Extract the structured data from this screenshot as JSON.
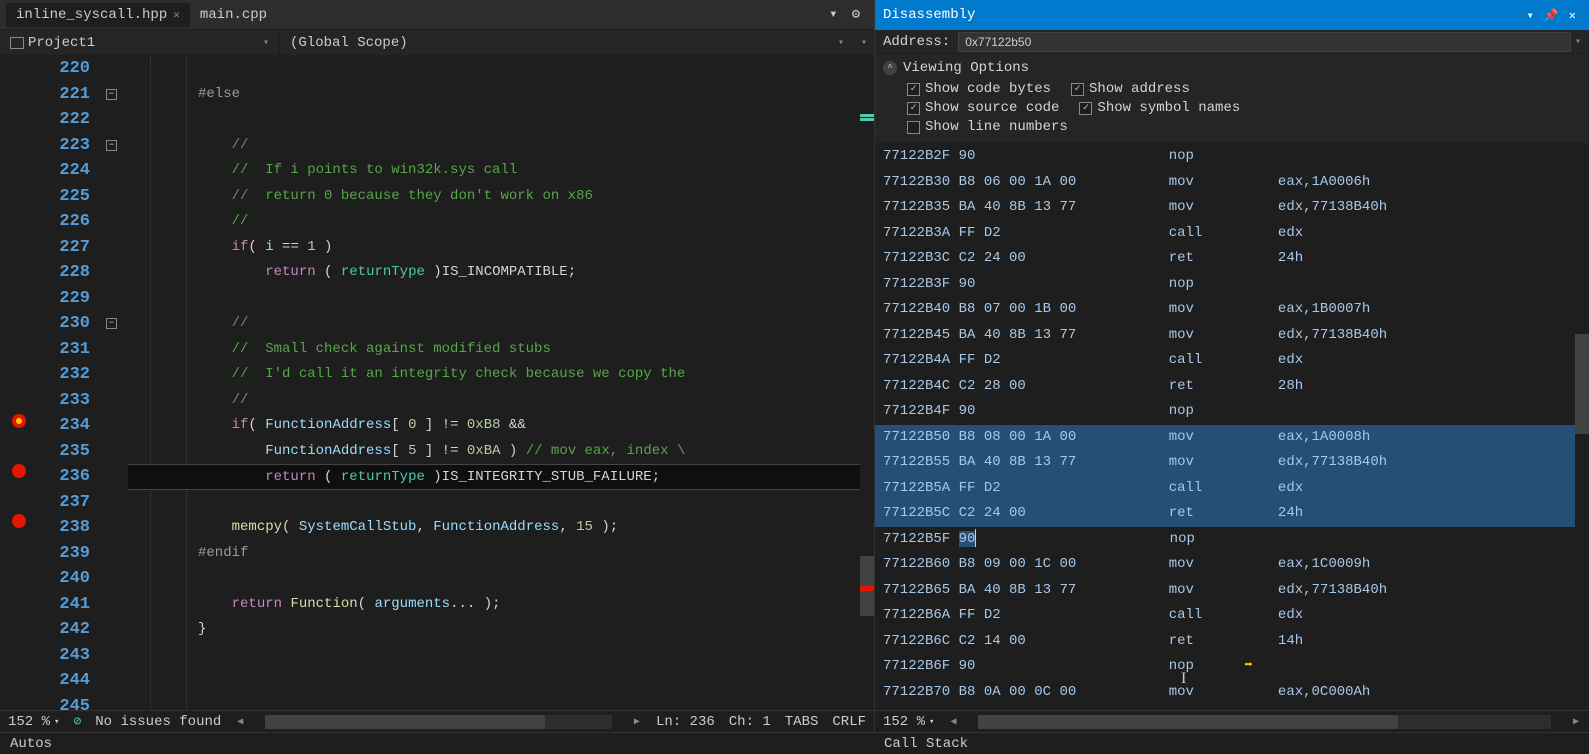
{
  "tabs": {
    "active": "inline_syscall.hpp",
    "second": "main.cpp"
  },
  "nav": {
    "project": "Project1",
    "scope": "(Global Scope)"
  },
  "zoom": "152 %",
  "status": {
    "issues": "No issues found",
    "line": "Ln: 236",
    "col": "Ch: 1",
    "tabs": "TABS",
    "crlf": "CRLF"
  },
  "code": {
    "start": 220,
    "lines": [
      {
        "n": 220,
        "html": ""
      },
      {
        "n": 221,
        "html": "<span class='pre'>#else</span>",
        "fold": true
      },
      {
        "n": 222,
        "html": ""
      },
      {
        "n": 223,
        "html": "    <span class='cm'>//</span>",
        "fold": true
      },
      {
        "n": 224,
        "html": "    <span class='cm'>//  If i points to win32k.sys call</span>"
      },
      {
        "n": 225,
        "html": "    <span class='cm'>//  return 0 because they don't work on x86</span>"
      },
      {
        "n": 226,
        "html": "    <span class='cm'>//</span>"
      },
      {
        "n": 227,
        "html": "    <span class='kw'>if</span><span class='txt'>( </span><span class='param'>i</span><span class='txt'> == </span><span class='num'>1</span><span class='txt'> )</span>"
      },
      {
        "n": 228,
        "html": "        <span class='kw'>return</span><span class='txt'> ( </span><span class='ty'>returnType</span><span class='txt'> )</span><span class='txt'>IS_INCOMPATIBLE;</span>"
      },
      {
        "n": 229,
        "html": ""
      },
      {
        "n": 230,
        "html": "    <span class='cm'>//</span>",
        "fold": true
      },
      {
        "n": 231,
        "html": "    <span class='cm'>//  Small check against modified stubs</span>"
      },
      {
        "n": 232,
        "html": "    <span class='cm'>//  I'd call it an integrity check because we copy the</span>"
      },
      {
        "n": 233,
        "html": "    <span class='cm'>//</span>"
      },
      {
        "n": 234,
        "html": "    <span class='kw'>if</span><span class='txt'>( </span><span class='param'>FunctionAddress</span><span class='txt'>[ </span><span class='num'>0</span><span class='txt'> ] != </span><span class='num'>0xB8</span><span class='txt'> &amp;&amp;</span>",
        "bp": "active"
      },
      {
        "n": 235,
        "html": "        <span class='param'>FunctionAddress</span><span class='txt'>[ </span><span class='num'>5</span><span class='txt'> ] != </span><span class='num'>0xBA</span><span class='txt'> ) </span><span class='cm'>// mov eax, index \\</span>"
      },
      {
        "n": 236,
        "html": "        <span class='kw'>return</span><span class='txt'> ( </span><span class='ty'>returnType</span><span class='txt'> )IS_INTEGRITY_STUB_FAILURE;</span>",
        "bp": "normal",
        "current": true
      },
      {
        "n": 237,
        "html": ""
      },
      {
        "n": 238,
        "html": "    <span class='fn'>memcpy</span><span class='txt'>( </span><span class='param'>SystemCallStub</span><span class='txt'>, </span><span class='param'>FunctionAddress</span><span class='txt'>, </span><span class='num'>15</span><span class='txt'> );</span>",
        "bp": "normal"
      },
      {
        "n": 239,
        "html": "<span class='pre'>#endif</span>"
      },
      {
        "n": 240,
        "html": ""
      },
      {
        "n": 241,
        "html": "    <span class='kw'>return</span><span class='txt'> </span><span class='fn'>Function</span><span class='txt'>( </span><span class='param'>arguments</span><span class='txt'>... );</span>"
      },
      {
        "n": 242,
        "html": "<span class='txt'>}</span>"
      },
      {
        "n": 243,
        "html": ""
      },
      {
        "n": 244,
        "html": ""
      },
      {
        "n": 245,
        "html": ""
      }
    ]
  },
  "disasm": {
    "title": "Disassembly",
    "address_label": "Address:",
    "address_value": "0x77122b50",
    "viewing_options_label": "Viewing Options",
    "opts": {
      "code_bytes": "Show code bytes",
      "address": "Show address",
      "source": "Show source code",
      "symbols": "Show symbol names",
      "line_nums": "Show line numbers"
    },
    "zoom": "152 %",
    "lines": [
      {
        "addr": "77122B2F",
        "bytes": "90",
        "mnem": "nop",
        "oper": ""
      },
      {
        "addr": "77122B30",
        "bytes": "B8 06 00 1A 00",
        "mnem": "mov",
        "oper": "eax,1A0006h"
      },
      {
        "addr": "77122B35",
        "bytes": "BA 40 8B 13 77",
        "mnem": "mov",
        "oper": "edx,77138B40h"
      },
      {
        "addr": "77122B3A",
        "bytes": "FF D2",
        "mnem": "call",
        "oper": "edx"
      },
      {
        "addr": "77122B3C",
        "bytes": "C2 24 00",
        "mnem": "ret",
        "oper": "24h"
      },
      {
        "addr": "77122B3F",
        "bytes": "90",
        "mnem": "nop",
        "oper": ""
      },
      {
        "addr": "77122B40",
        "bytes": "B8 07 00 1B 00",
        "mnem": "mov",
        "oper": "eax,1B0007h"
      },
      {
        "addr": "77122B45",
        "bytes": "BA 40 8B 13 77",
        "mnem": "mov",
        "oper": "edx,77138B40h"
      },
      {
        "addr": "77122B4A",
        "bytes": "FF D2",
        "mnem": "call",
        "oper": "edx"
      },
      {
        "addr": "77122B4C",
        "bytes": "C2 28 00",
        "mnem": "ret",
        "oper": "28h"
      },
      {
        "addr": "77122B4F",
        "bytes": "90",
        "mnem": "nop",
        "oper": ""
      },
      {
        "addr": "77122B50",
        "bytes": "B8 08 00 1A 00",
        "mnem": "mov",
        "oper": "eax,1A0008h",
        "sel": true
      },
      {
        "addr": "77122B55",
        "bytes": "BA 40 8B 13 77",
        "mnem": "mov",
        "oper": "edx,77138B40h",
        "sel": true
      },
      {
        "addr": "77122B5A",
        "bytes": "FF D2",
        "mnem": "call",
        "oper": "edx",
        "sel": true
      },
      {
        "addr": "77122B5C",
        "bytes": "C2 24 00",
        "mnem": "ret",
        "oper": "24h",
        "sel": true
      },
      {
        "addr": "77122B5F",
        "bytes": "90",
        "mnem": "nop",
        "oper": "",
        "sel": "partial"
      },
      {
        "addr": "77122B60",
        "bytes": "B8 09 00 1C 00",
        "mnem": "mov",
        "oper": "eax,1C0009h"
      },
      {
        "addr": "77122B65",
        "bytes": "BA 40 8B 13 77",
        "mnem": "mov",
        "oper": "edx,77138B40h"
      },
      {
        "addr": "77122B6A",
        "bytes": "FF D2",
        "mnem": "call",
        "oper": "edx"
      },
      {
        "addr": "77122B6C",
        "bytes": "C2 14 00",
        "mnem": "ret",
        "oper": "14h"
      },
      {
        "addr": "77122B6F",
        "bytes": "90",
        "mnem": "nop",
        "oper": "",
        "arrow": true
      },
      {
        "addr": "77122B70",
        "bytes": "B8 0A 00 0C 00",
        "mnem": "mov",
        "oper": "eax,0C000Ah"
      }
    ]
  },
  "bottom": {
    "left": "Autos",
    "right": "Call Stack"
  }
}
